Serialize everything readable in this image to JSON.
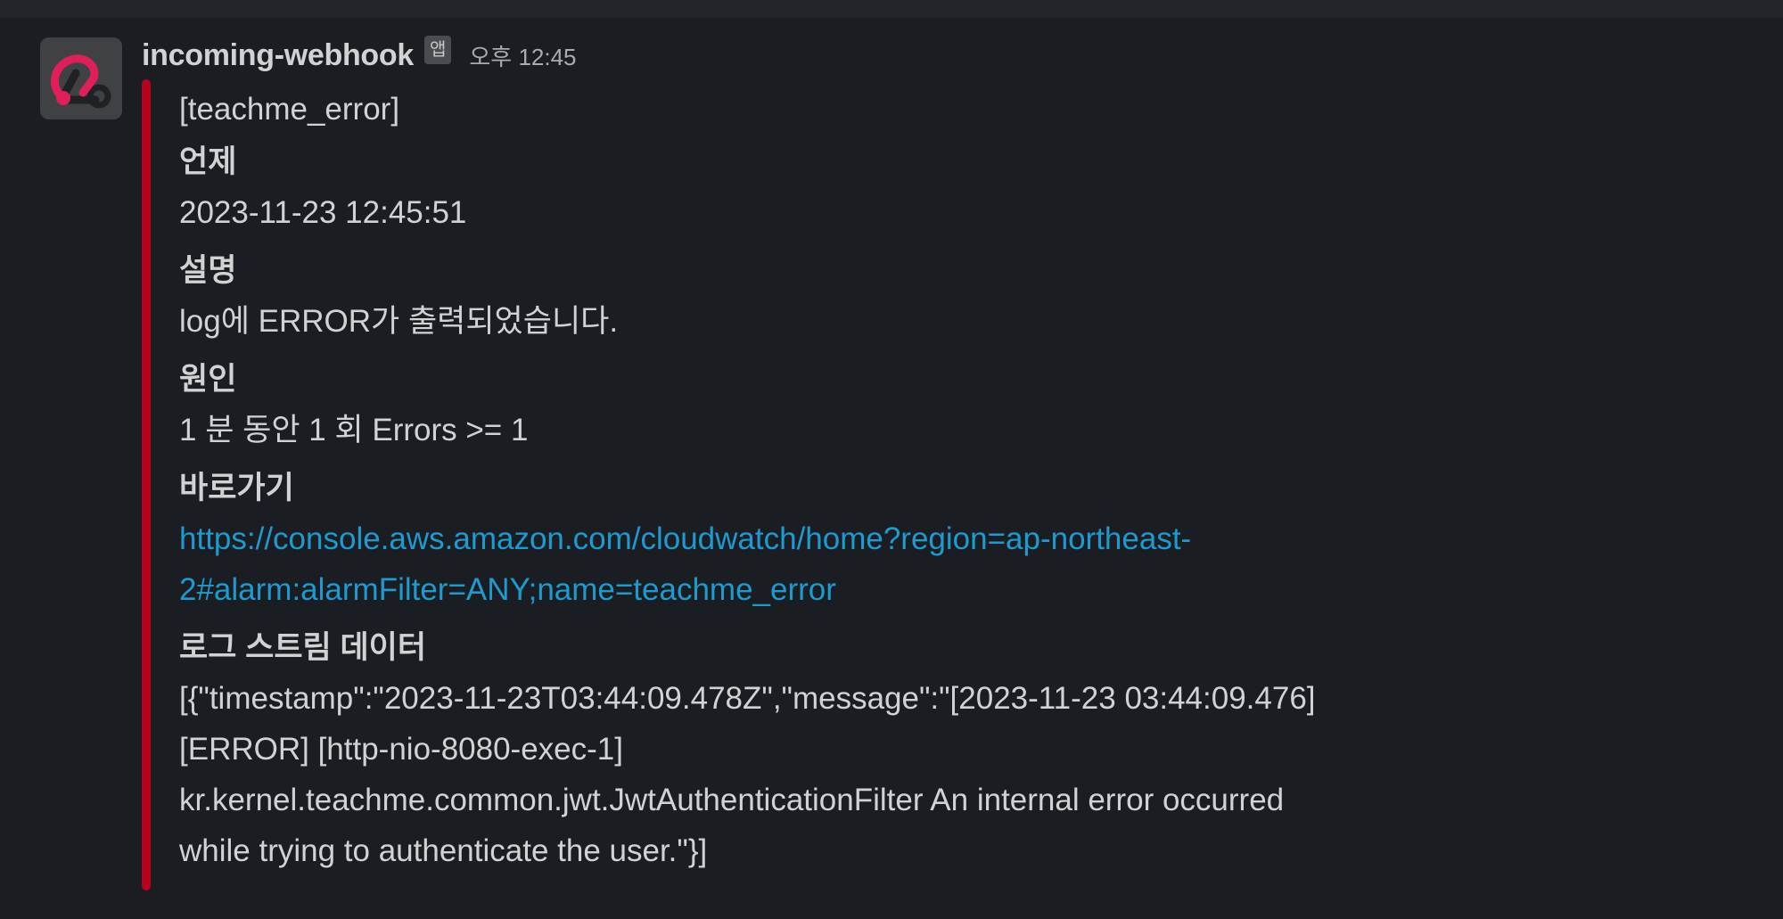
{
  "message": {
    "username": "incoming-webhook",
    "app_badge": "앱",
    "time": "오후 12:45",
    "accent_color": "#b8001f",
    "attachment": {
      "title": "[teachme_error]",
      "fields": [
        {
          "title": "언제",
          "value": "2023-11-23 12:45:51"
        },
        {
          "title": "설명",
          "value": "log에 ERROR가 출력되었습니다."
        },
        {
          "title": "원인",
          "value": "1 분 동안 1 회 Errors >= 1"
        }
      ],
      "link_field": {
        "title": "바로가기",
        "line1": "https://console.aws.amazon.com/cloudwatch/home?region=ap-northeast-",
        "line2": "2#alarm:alarmFilter=ANY;name=teachme_error"
      },
      "log_field": {
        "title": "로그 스트림 데이터",
        "lines": [
          "[{\"timestamp\":\"2023-11-23T03:44:09.478Z\",\"message\":\"[2023-11-23 03:44:09.476]",
          "[ERROR] [http-nio-8080-exec-1]",
          "kr.kernel.teachme.common.jwt.JwtAuthenticationFilter An internal error occurred",
          "while trying to authenticate the user.\"}]"
        ]
      }
    },
    "avatar_icon": "webhook-icon"
  }
}
